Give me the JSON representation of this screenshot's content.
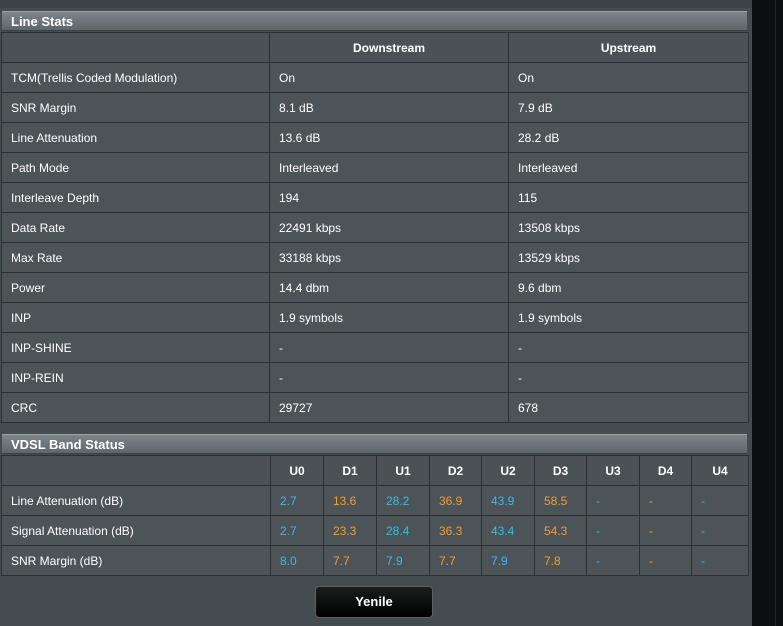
{
  "line_stats": {
    "title": "Line Stats",
    "columns": [
      "",
      "Downstream",
      "Upstream"
    ],
    "rows": [
      {
        "label": "TCM(Trellis Coded Modulation)",
        "down": "On",
        "up": "On"
      },
      {
        "label": "SNR Margin",
        "down": "8.1 dB",
        "up": "7.9 dB"
      },
      {
        "label": "Line Attenuation",
        "down": "13.6 dB",
        "up": "28.2 dB"
      },
      {
        "label": "Path Mode",
        "down": "Interleaved",
        "up": "Interleaved"
      },
      {
        "label": "Interleave Depth",
        "down": "194",
        "up": "115"
      },
      {
        "label": "Data Rate",
        "down": "22491 kbps",
        "up": "13508 kbps"
      },
      {
        "label": "Max Rate",
        "down": "33188 kbps",
        "up": "13529 kbps"
      },
      {
        "label": "Power",
        "down": "14.4 dbm",
        "up": "9.6 dbm"
      },
      {
        "label": "INP",
        "down": "1.9 symbols",
        "up": "1.9 symbols"
      },
      {
        "label": "INP-SHINE",
        "down": "-",
        "up": "-"
      },
      {
        "label": "INP-REIN",
        "down": "-",
        "up": "-"
      },
      {
        "label": "CRC",
        "down": "29727",
        "up": "678"
      }
    ]
  },
  "band_status": {
    "title": "VDSL Band Status",
    "bands": [
      "U0",
      "D1",
      "U1",
      "D2",
      "U2",
      "D3",
      "U3",
      "D4",
      "U4"
    ],
    "rows": [
      {
        "label": "Line Attenuation (dB)",
        "values": [
          "2.7",
          "13.6",
          "28.2",
          "36.9",
          "43.9",
          "58.5",
          "-",
          "-",
          "-"
        ]
      },
      {
        "label": "Signal Attenuation (dB)",
        "values": [
          "2.7",
          "23.3",
          "28.4",
          "36.3",
          "43.4",
          "54.3",
          "-",
          "-",
          "-"
        ]
      },
      {
        "label": "SNR Margin (dB)",
        "values": [
          "8.0",
          "7.7",
          "7.9",
          "7.7",
          "7.9",
          "7.8",
          "-",
          "-",
          "-"
        ]
      }
    ]
  },
  "actions": {
    "refresh_label": "Yenile"
  },
  "colors": {
    "upstream_value": "#3fb6ea",
    "downstream_value": "#f29b35",
    "panel_bg": "#444c50"
  }
}
